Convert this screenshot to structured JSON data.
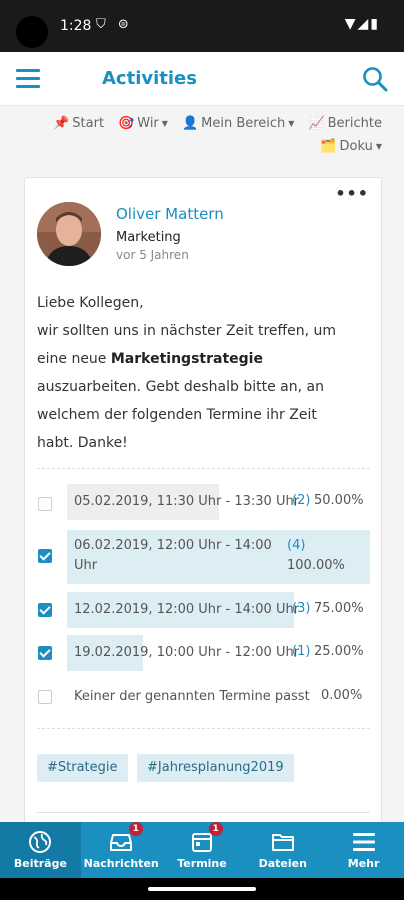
{
  "status": {
    "time": "1:28"
  },
  "header": {
    "title": "Activities"
  },
  "nav": {
    "start": "Start",
    "wir": "Wir",
    "mein_bereich": "Mein Bereich",
    "berichte": "Berichte",
    "doku": "Doku"
  },
  "post": {
    "author": "Oliver Mattern",
    "department": "Marketing",
    "time": "vor 5 Jahren",
    "text_line1": "Liebe Kollegen,",
    "text_line2": "wir sollten uns in nächster Zeit treffen, um",
    "text_line3a": "eine neue ",
    "text_line3b": "Marketingstrategie",
    "text_line4": "auszuarbeiten. Gebt deshalb bitte an, an",
    "text_line5": "welchem der folgenden Termine ihr Zeit",
    "text_line6": "habt. Danke!"
  },
  "poll": {
    "options": [
      {
        "label": "05.02.2019, 11:30 Uhr - 13:30 Uhr",
        "count": "(2)",
        "percent": "50.00%",
        "share": 0.5,
        "checked": false
      },
      {
        "label_l1": "06.02.2019, 12:00 Uhr - 14:00",
        "label_l2": "Uhr",
        "count": "(4)",
        "percent": "100.00%",
        "share": 1.0,
        "checked": true
      },
      {
        "label": "12.02.2019, 12:00 Uhr - 14:00 Uhr",
        "count": "(3)",
        "percent": "75.00%",
        "share": 0.75,
        "checked": true
      },
      {
        "label": "19.02.2019, 10:00 Uhr - 12:00 Uhr",
        "count": "(1)",
        "percent": "25.00%",
        "share": 0.25,
        "checked": true
      },
      {
        "label": "Keiner der genannten Termine passt",
        "percent": "0.00%",
        "share": 0.0,
        "checked": false
      }
    ]
  },
  "tags": [
    "#Strategie",
    "#Jahresplanung2019"
  ],
  "bottom_nav": {
    "beitraege": "Beiträge",
    "nachrichten": "Nachrichten",
    "nachrichten_badge": "1",
    "termine": "Termine",
    "termine_badge": "1",
    "dateien": "Dateien",
    "mehr": "Mehr"
  },
  "colors": {
    "accent": "#1b8fbf",
    "badge": "#c0213a",
    "bar": "#dcedf4"
  }
}
